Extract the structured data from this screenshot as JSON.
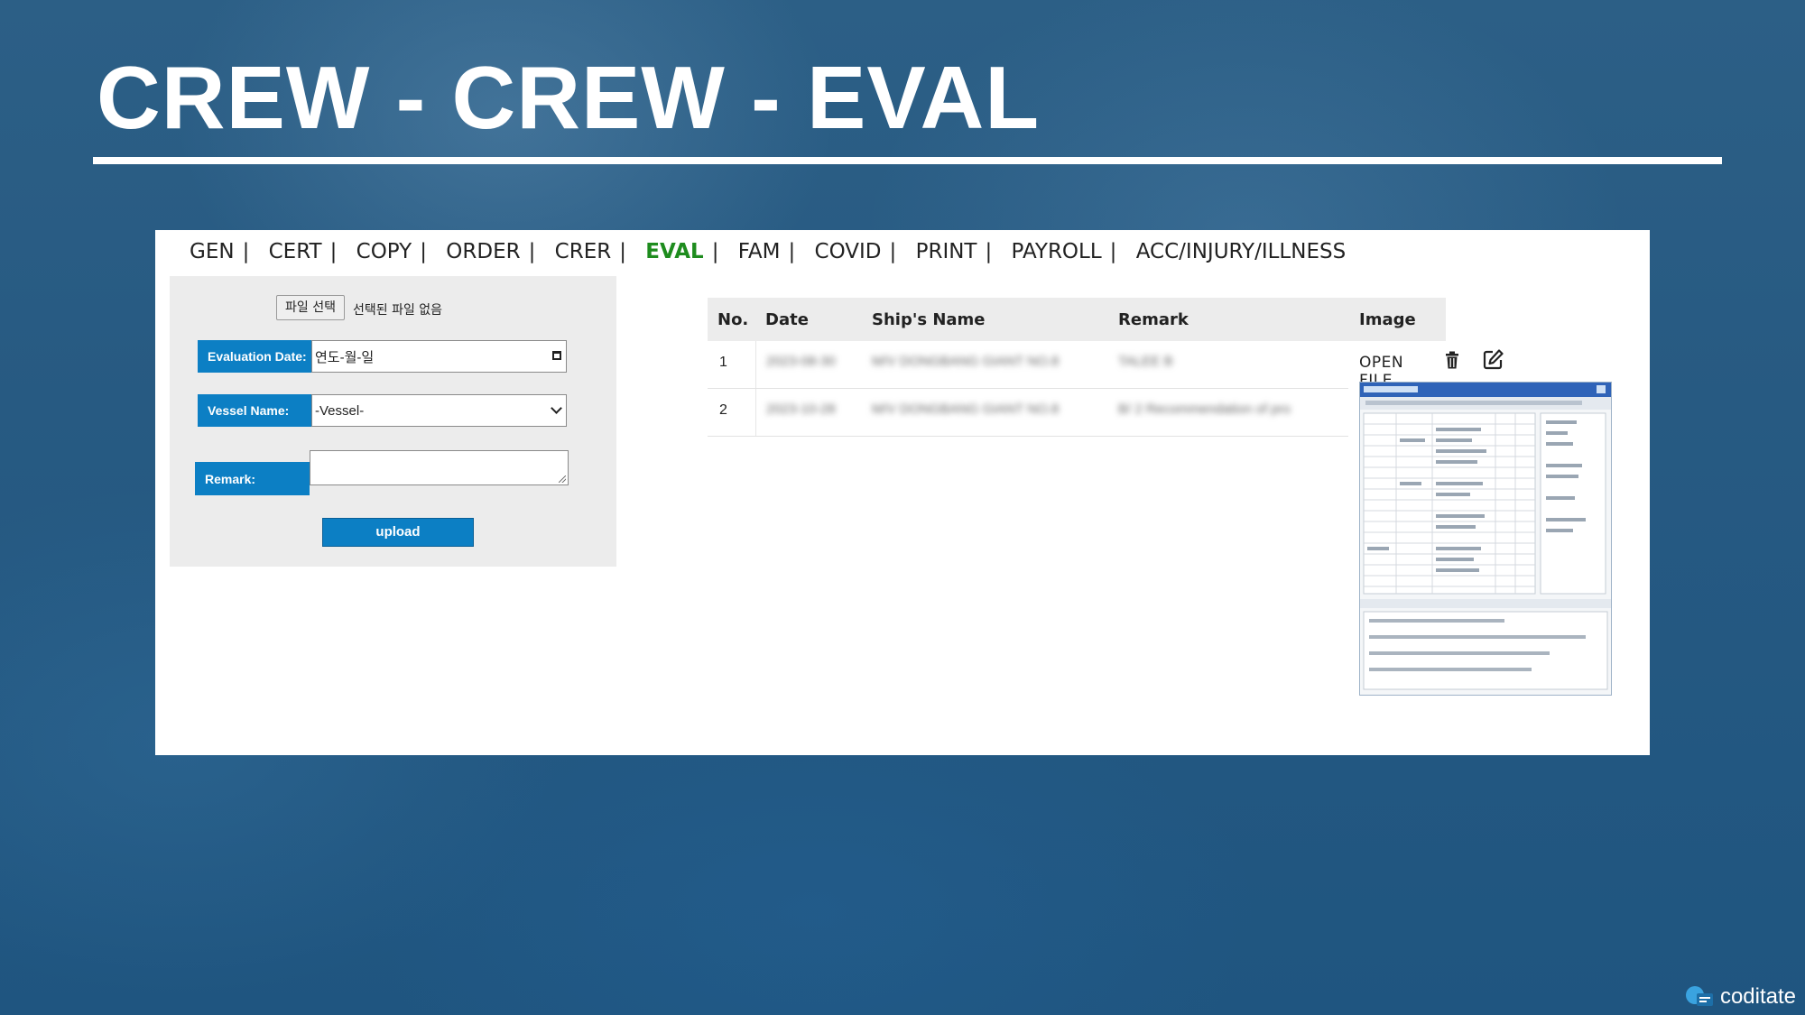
{
  "slide": {
    "title": "CREW - CREW - EVAL"
  },
  "nav": {
    "items": [
      "GEN",
      "CERT",
      "COPY",
      "ORDER",
      "CRER",
      "EVAL",
      "FAM",
      "COVID",
      "PRINT",
      "PAYROLL",
      "ACC/INJURY/ILLNESS"
    ],
    "separator": "|",
    "active": "EVAL",
    "active_color": "#1e8c1e"
  },
  "form": {
    "file_button": "파일 선택",
    "file_status": "선택된 파일 없음",
    "evaluation_date_label": "Evaluation Date:",
    "evaluation_date_placeholder": "연도-월-일",
    "vessel_label": "Vessel Name:",
    "vessel_value": "-Vessel-",
    "remark_label": "Remark:",
    "remark_value": "",
    "upload_label": "upload",
    "accent_color": "#0c7fc4"
  },
  "table": {
    "headers": {
      "no": "No.",
      "date": "Date",
      "ship": "Ship's Name",
      "remark": "Remark",
      "image": "Image"
    },
    "rows": [
      {
        "no": "1",
        "date": "2023-08-30",
        "ship": "M/V DONGBANG GIANT NO.8",
        "remark": "TALEE B"
      },
      {
        "no": "2",
        "date": "2023-10-28",
        "ship": "M/V DONGBANG GIANT NO.8",
        "remark": "B/ 2 Recommendation of pro"
      }
    ],
    "open_file_label": "OPEN FILE",
    "delete_icon": "trash-icon",
    "edit_icon": "edit-icon"
  },
  "brand": {
    "name": "coditate"
  }
}
